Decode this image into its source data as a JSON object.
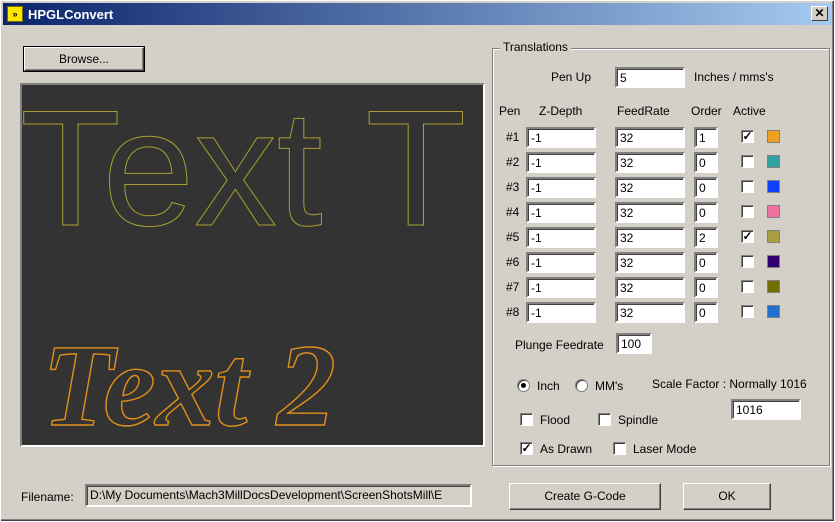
{
  "window": {
    "title": "HPGLConvert",
    "app_icon_glyph": "»",
    "close_glyph": "✕"
  },
  "browse_label": "Browse...",
  "preview": {
    "text1": "Text T",
    "text2": "Text 2",
    "text1_color": "#a8a030",
    "text2_color": "#e0901a",
    "background": "#333333"
  },
  "translations": {
    "group_title": "Translations",
    "pen_up_label": "Pen Up",
    "pen_up_value": "5",
    "units_label": "Inches / mms's",
    "headers": {
      "pen": "Pen",
      "zdepth": "Z-Depth",
      "feedrate": "FeedRate",
      "order": "Order",
      "active": "Active"
    },
    "pens": [
      {
        "label": "#1",
        "zdepth": "-1",
        "feedrate": "32",
        "order": "1",
        "active": true,
        "color": "#f0a020"
      },
      {
        "label": "#2",
        "zdepth": "-1",
        "feedrate": "32",
        "order": "0",
        "active": false,
        "color": "#30a0a0"
      },
      {
        "label": "#3",
        "zdepth": "-1",
        "feedrate": "32",
        "order": "0",
        "active": false,
        "color": "#1040ff"
      },
      {
        "label": "#4",
        "zdepth": "-1",
        "feedrate": "32",
        "order": "0",
        "active": false,
        "color": "#f070a0"
      },
      {
        "label": "#5",
        "zdepth": "-1",
        "feedrate": "32",
        "order": "2",
        "active": true,
        "color": "#a8a040"
      },
      {
        "label": "#6",
        "zdepth": "-1",
        "feedrate": "32",
        "order": "0",
        "active": false,
        "color": "#300070"
      },
      {
        "label": "#7",
        "zdepth": "-1",
        "feedrate": "32",
        "order": "0",
        "active": false,
        "color": "#707000"
      },
      {
        "label": "#8",
        "zdepth": "-1",
        "feedrate": "32",
        "order": "0",
        "active": false,
        "color": "#2070d0"
      }
    ],
    "plunge_label": "Plunge Feedrate",
    "plunge_value": "100",
    "inch_label": "Inch",
    "mm_label": "MM's",
    "units_selected": "inch",
    "scale_label": "Scale Factor : Normally 1016",
    "scale_value": "1016",
    "flood_label": "Flood",
    "flood_checked": false,
    "spindle_label": "Spindle",
    "spindle_checked": false,
    "as_drawn_label": "As Drawn",
    "as_drawn_checked": true,
    "laser_label": "Laser Mode",
    "laser_checked": false
  },
  "filename_label": "Filename:",
  "filename_value": "D:\\My Documents\\Mach3MillDocsDevelopment\\ScreenShotsMill\\E",
  "create_label": "Create  G-Code",
  "ok_label": "OK"
}
